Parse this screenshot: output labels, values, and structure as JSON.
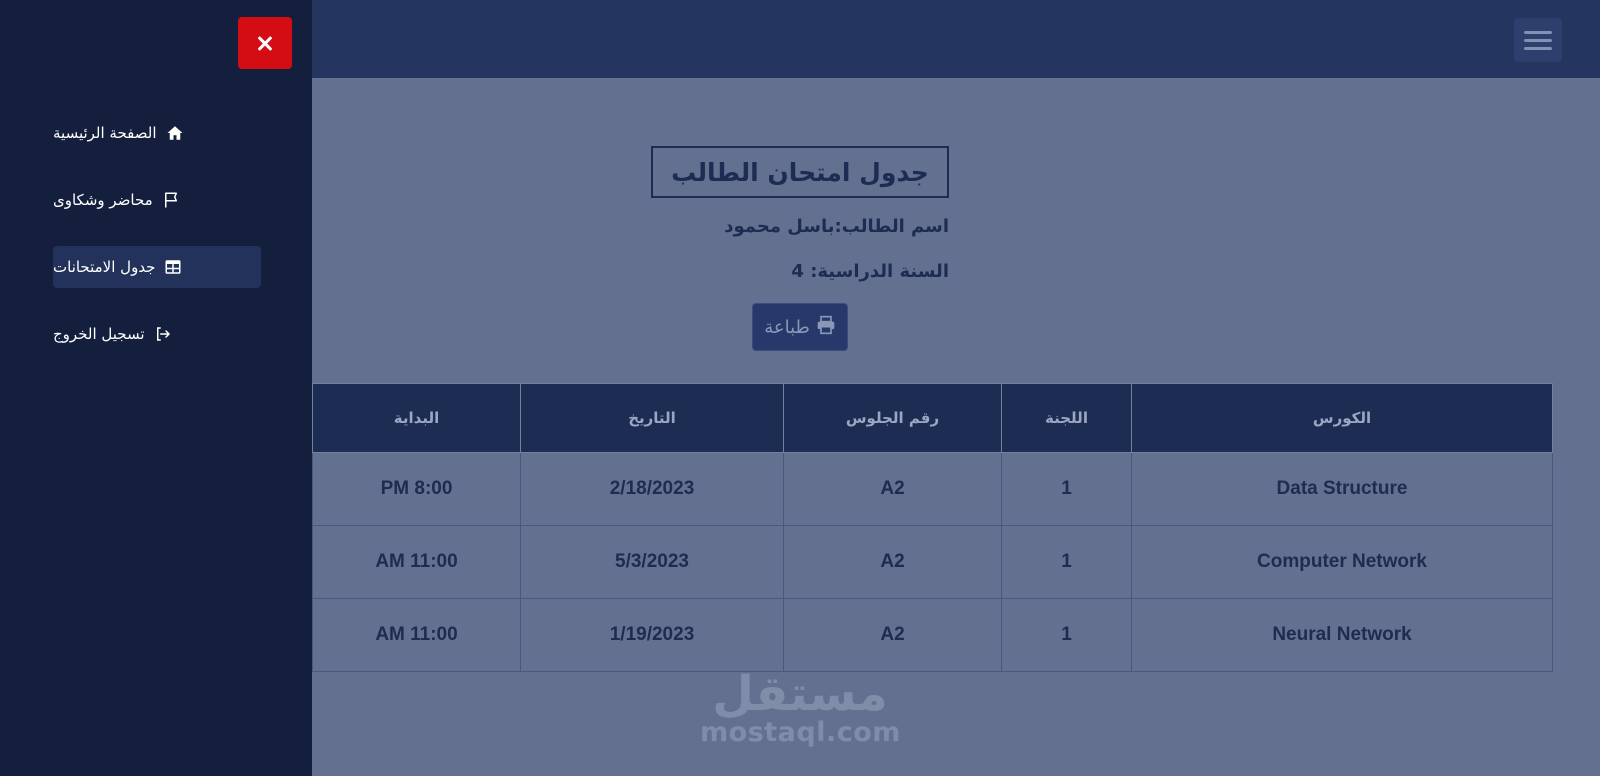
{
  "sidebar": {
    "items": [
      {
        "label": "الصفحة الرئيسية",
        "icon": "home-icon",
        "active": false
      },
      {
        "label": "محاضر وشكاوى",
        "icon": "flag-icon",
        "active": false
      },
      {
        "label": "جدول الامتحانات",
        "icon": "table-icon",
        "active": true
      },
      {
        "label": "تسجيل الخروج",
        "icon": "logout-icon",
        "active": false
      }
    ]
  },
  "main": {
    "title": "جدول امتحان الطالب",
    "student_name_line": "اسم الطالب:باسل محمود",
    "year_line": "السنة الدراسية: 4",
    "print_label": "طباعة"
  },
  "table": {
    "headers": [
      "الكورس",
      "اللجنة",
      "رقم الجلوس",
      "التاريخ",
      "البداية"
    ],
    "rows": [
      [
        "Data Structure",
        "1",
        "A2",
        "2/18/2023",
        "PM 8:00"
      ],
      [
        "Computer Network",
        "1",
        "A2",
        "5/3/2023",
        "AM 11:00"
      ],
      [
        "Neural Network",
        "1",
        "A2",
        "1/19/2023",
        "AM 11:00"
      ]
    ]
  },
  "watermark": {
    "arabic": "مستقل",
    "latin": "mostaql.com"
  },
  "colors": {
    "sidebar": "#131f3d",
    "topbar": "#243560",
    "content": "#637090",
    "close": "#d40c14",
    "table_header": "#1c2c52"
  }
}
